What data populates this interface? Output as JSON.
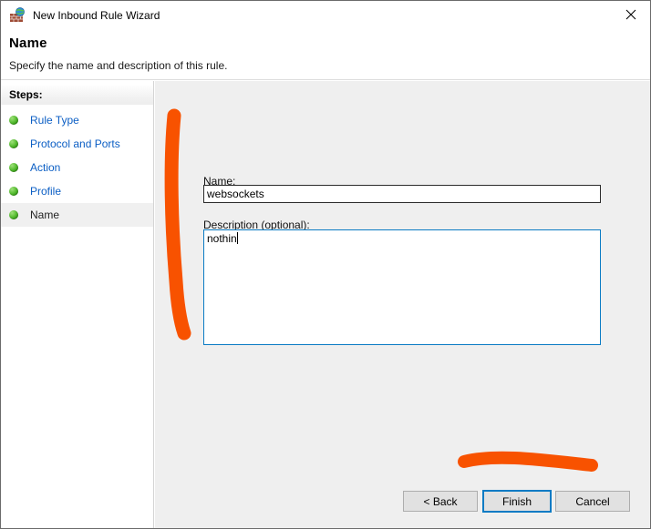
{
  "window": {
    "title": "New Inbound Rule Wizard",
    "title_icon": "firewall-globe-icon",
    "close_icon": "close-icon"
  },
  "header": {
    "title": "Name",
    "subtitle": "Specify the name and description of this rule."
  },
  "sidebar": {
    "heading": "Steps:",
    "items": [
      {
        "label": "Rule Type",
        "current": false
      },
      {
        "label": "Protocol and Ports",
        "current": false
      },
      {
        "label": "Action",
        "current": false
      },
      {
        "label": "Profile",
        "current": false
      },
      {
        "label": "Name",
        "current": true
      }
    ]
  },
  "form": {
    "name_label": "Name:",
    "name_value": "websockets",
    "name_placeholder": "",
    "description_label": "Description (optional):",
    "description_value": "nothin",
    "description_placeholder": ""
  },
  "footer": {
    "back_label": "< Back",
    "finish_label": "Finish",
    "cancel_label": "Cancel"
  },
  "annotations": {
    "color": "#f85200",
    "strokes": [
      {
        "name": "vertical-stroke",
        "orientation": "vertical"
      },
      {
        "name": "horizontal-stroke",
        "orientation": "horizontal"
      }
    ]
  },
  "colors": {
    "accent_blue": "#0a7bc4",
    "link_blue": "#0b5ec4",
    "panel_gray": "#efefef",
    "annotation_orange": "#f85200"
  }
}
